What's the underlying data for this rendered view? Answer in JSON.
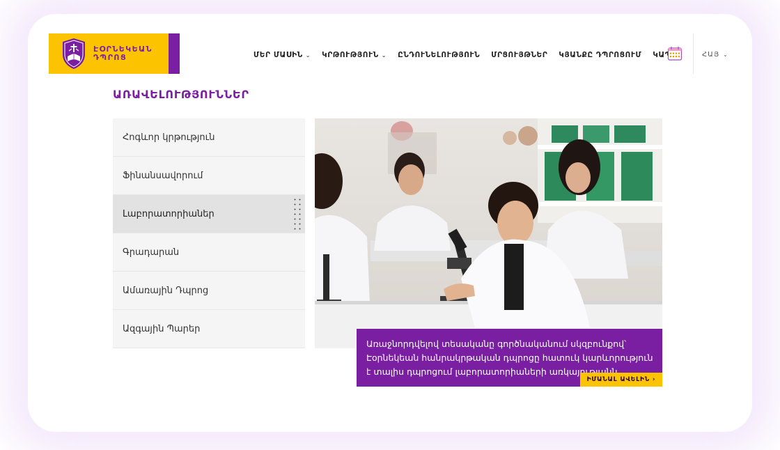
{
  "brand": {
    "line1": "ԷՕՐՆԵԿԵԱՆ",
    "line2": "ԴՊՐՈՑ",
    "accent": "#7a1fa2",
    "yellow": "#fcc400"
  },
  "nav": {
    "items": [
      {
        "label": "ՄԵՐ ՄԱՍԻՆ",
        "has_dropdown": true
      },
      {
        "label": "ԿՐԹՈՒԹՅՈՒՆ",
        "has_dropdown": true
      },
      {
        "label": "ԸՆԴՈՒՆԵԼՈՒԹՅՈՒՆ",
        "has_dropdown": false
      },
      {
        "label": "ՄՐՑՈՒՅԹՆԵՐ",
        "has_dropdown": false
      },
      {
        "label": "ԿՅԱՆՔԸ ԴՊՐՈՑՈՒՄ",
        "has_dropdown": false
      },
      {
        "label": "ԿԱՊ",
        "has_dropdown": false
      }
    ],
    "calendar_icon": "calendar-icon",
    "language": "ՀԱՅ"
  },
  "section": {
    "title": "ԱՌԱՎԵԼՈՒԹՅՈՒՆՆԵՐ",
    "menu": [
      "Հոգևոր կրթություն",
      "Ֆինանսավորում",
      "Լաբորատորիաներ",
      "Գրադարան",
      "Ամառային Դպրոց",
      "Ազգային Պարեր"
    ],
    "active_index": 2,
    "caption": "Առաջնորդվելով տեսականը գործնականում սկզբունքով՝ Էօրնեկեան հանրակրթական դպրոցը հատուկ կարևորություն է տալիս դպրոցում լաբորատորիաների առկայությանն...",
    "read_more": "ԻՄԱՆԱԼ ԱՎԵԼԻՆ ›"
  }
}
